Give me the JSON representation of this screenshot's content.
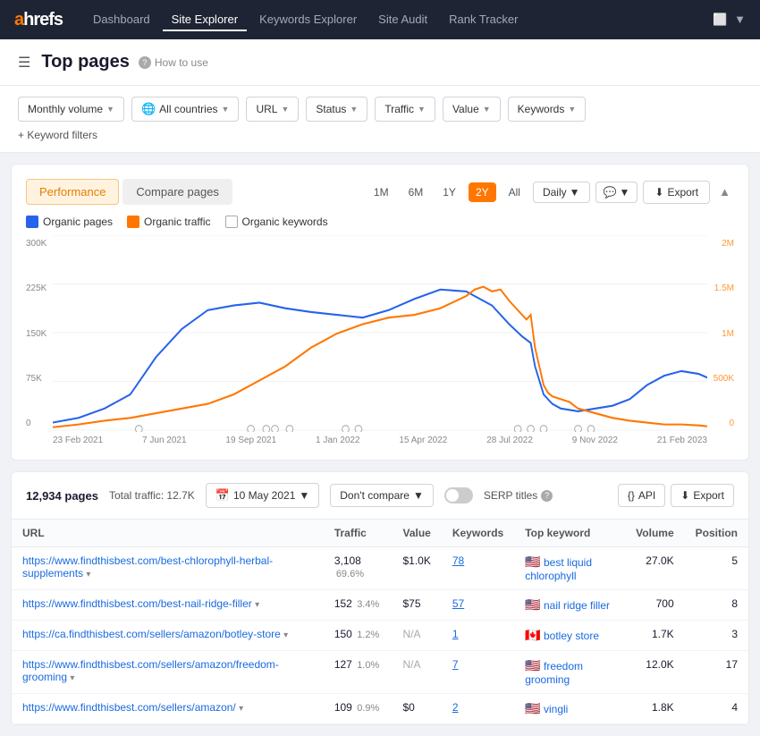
{
  "nav": {
    "logo": "ahrefs",
    "links": [
      "Dashboard",
      "Site Explorer",
      "Keywords Explorer",
      "Site Audit",
      "Rank Tracker"
    ],
    "active_link": "Site Explorer"
  },
  "page": {
    "title": "Top pages",
    "how_to_use": "How to use"
  },
  "filters": {
    "monthly_volume": "Monthly volume",
    "all_countries": "All countries",
    "url": "URL",
    "status": "Status",
    "traffic": "Traffic",
    "value": "Value",
    "keywords": "Keywords",
    "add_filter": "+ Keyword filters"
  },
  "chart": {
    "tab_performance": "Performance",
    "tab_compare": "Compare pages",
    "time_buttons": [
      "1M",
      "6M",
      "1Y",
      "2Y",
      "All"
    ],
    "active_time": "2Y",
    "interval": "Daily",
    "export": "Export",
    "legend": {
      "organic_pages": "Organic pages",
      "organic_traffic": "Organic traffic",
      "organic_keywords": "Organic keywords"
    },
    "y_left": [
      "300K",
      "225K",
      "150K",
      "75K",
      "0"
    ],
    "y_right": [
      "2M",
      "1.5M",
      "1M",
      "500K",
      "0"
    ],
    "x_axis": [
      "23 Feb 2021",
      "7 Jun 2021",
      "19 Sep 2021",
      "1 Jan 2022",
      "15 Apr 2022",
      "28 Jul 2022",
      "9 Nov 2022",
      "21 Feb 2023"
    ]
  },
  "table": {
    "pages_count": "12,934 pages",
    "total_traffic": "Total traffic: 12.7K",
    "date": "10 May 2021",
    "dont_compare": "Don't compare",
    "serp_titles": "SERP titles",
    "api": "API",
    "export": "Export",
    "columns": {
      "url": "URL",
      "traffic": "Traffic",
      "value": "Value",
      "keywords": "Keywords",
      "top_keyword": "Top keyword",
      "volume": "Volume",
      "position": "Position"
    },
    "rows": [
      {
        "url": "https://www.findthisbest.com/best-chlorophyll-herbal-supplements",
        "traffic": "3,108",
        "traffic_pct": "69.6%",
        "value": "$1.0K",
        "keywords": "78",
        "top_keyword": "best liquid chlorophyll",
        "flag": "🇺🇸",
        "volume": "27.0K",
        "position": "5"
      },
      {
        "url": "https://www.findthisbest.com/best-nail-ridge-filler",
        "traffic": "152",
        "traffic_pct": "3.4%",
        "value": "$75",
        "keywords": "57",
        "top_keyword": "nail ridge filler",
        "flag": "🇺🇸",
        "volume": "700",
        "position": "8"
      },
      {
        "url": "https://ca.findthisbest.com/sellers/amazon/botley-store",
        "traffic": "150",
        "traffic_pct": "1.2%",
        "value": "N/A",
        "keywords": "1",
        "top_keyword": "botley store",
        "flag": "🇨🇦",
        "volume": "1.7K",
        "position": "3"
      },
      {
        "url": "https://www.findthisbest.com/sellers/amazon/freedom-grooming",
        "traffic": "127",
        "traffic_pct": "1.0%",
        "value": "N/A",
        "keywords": "7",
        "top_keyword": "freedom grooming",
        "flag": "🇺🇸",
        "volume": "12.0K",
        "position": "17"
      },
      {
        "url": "https://www.findthisbest.com/sellers/amazon/",
        "traffic": "109",
        "traffic_pct": "0.9%",
        "value": "$0",
        "keywords": "2",
        "top_keyword": "vingli",
        "flag": "🇺🇸",
        "volume": "1.8K",
        "position": "4"
      }
    ]
  }
}
